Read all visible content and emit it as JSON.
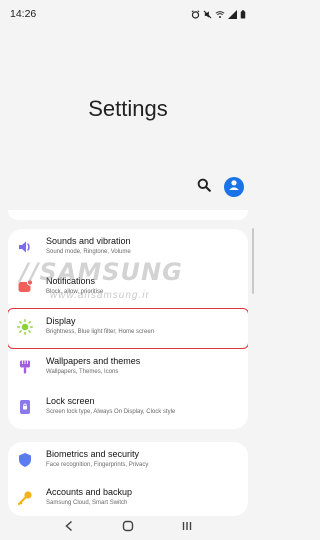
{
  "status": {
    "time": "14:26",
    "icons": [
      "alarm-icon",
      "mute-icon",
      "wifi-icon",
      "signal-icon",
      "battery-icon"
    ]
  },
  "header": {
    "title": "Settings",
    "search_icon": "search-icon",
    "account_icon": "account-icon",
    "accent": "#1a73e8"
  },
  "watermark": {
    "brand": "//SAMSUNG",
    "url": "www.allsamsung.ir"
  },
  "groups": [
    {
      "items": [
        {
          "title": "Sounds and vibration",
          "subtitle": "Sound mode, Ringtone, Volume",
          "icon": "speaker-icon",
          "color": "#7c6cf2"
        },
        {
          "title": "Notifications",
          "subtitle": "Block, allow, prioritise",
          "icon": "notification-icon",
          "color": "#f0605a"
        },
        {
          "title": "Display",
          "subtitle": "Brightness, Blue light filter, Home screen",
          "icon": "brightness-icon",
          "color": "#8bd13c",
          "selected": true
        },
        {
          "title": "Wallpapers and themes",
          "subtitle": "Wallpapers, Themes, Icons",
          "icon": "brush-icon",
          "color": "#a35ee0"
        },
        {
          "title": "Lock screen",
          "subtitle": "Screen lock type, Always On Display, Clock style",
          "icon": "lock-screen-icon",
          "color": "#8b78ea"
        }
      ]
    },
    {
      "items": [
        {
          "title": "Biometrics and security",
          "subtitle": "Face recognition, Fingerprints, Privacy",
          "icon": "shield-icon",
          "color": "#5b7cf0"
        },
        {
          "title": "Accounts and backup",
          "subtitle": "Samsung Cloud, Smart Switch",
          "icon": "key-icon",
          "color": "#f2b21c"
        }
      ]
    }
  ],
  "nav": {
    "back_icon": "back-icon",
    "home_icon": "home-icon",
    "recents_icon": "recents-icon"
  },
  "colors": {
    "selection_outline": "#d9363e",
    "background": "#f4f4f4"
  }
}
